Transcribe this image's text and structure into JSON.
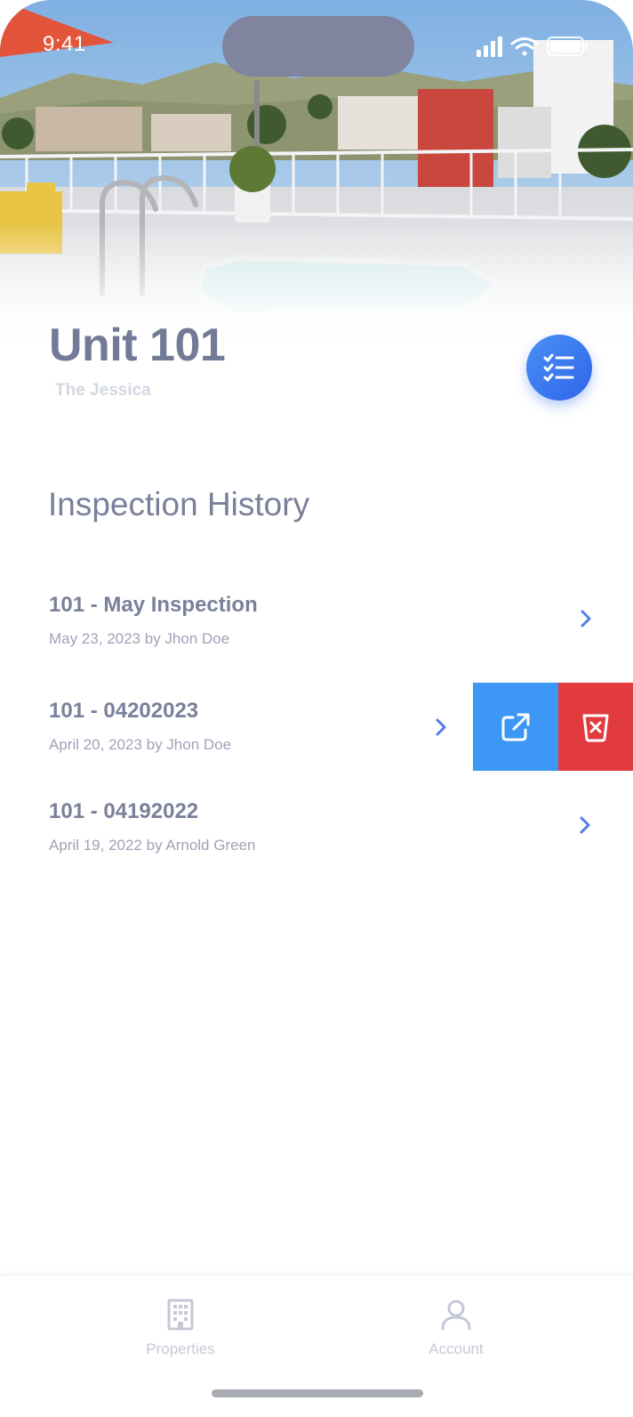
{
  "status_bar": {
    "time": "9:41"
  },
  "unit": {
    "title": "Unit 101",
    "property": "The Jessica"
  },
  "section": {
    "title": "Inspection History"
  },
  "inspections": [
    {
      "title": "101 - May Inspection",
      "meta": "May 23, 2023 by Jhon Doe"
    },
    {
      "title": "101 - 04202023",
      "meta": "April 20, 2023 by Jhon Doe"
    },
    {
      "title": "101 - 04192022",
      "meta": "April 19, 2022 by Arnold Green"
    }
  ],
  "swipe_actions": {
    "open_icon": "external-link-icon",
    "delete_icon": "delete-x-icon"
  },
  "fab": {
    "icon": "checklist-icon"
  },
  "tabbar": {
    "tabs": [
      {
        "label": "Properties",
        "icon": "building-icon"
      },
      {
        "label": "Account",
        "icon": "user-icon"
      }
    ]
  },
  "colors": {
    "accent": "#3c98f4",
    "danger": "#e13b40",
    "fab": "#2f66ea",
    "chevron": "#4f7ee8"
  }
}
